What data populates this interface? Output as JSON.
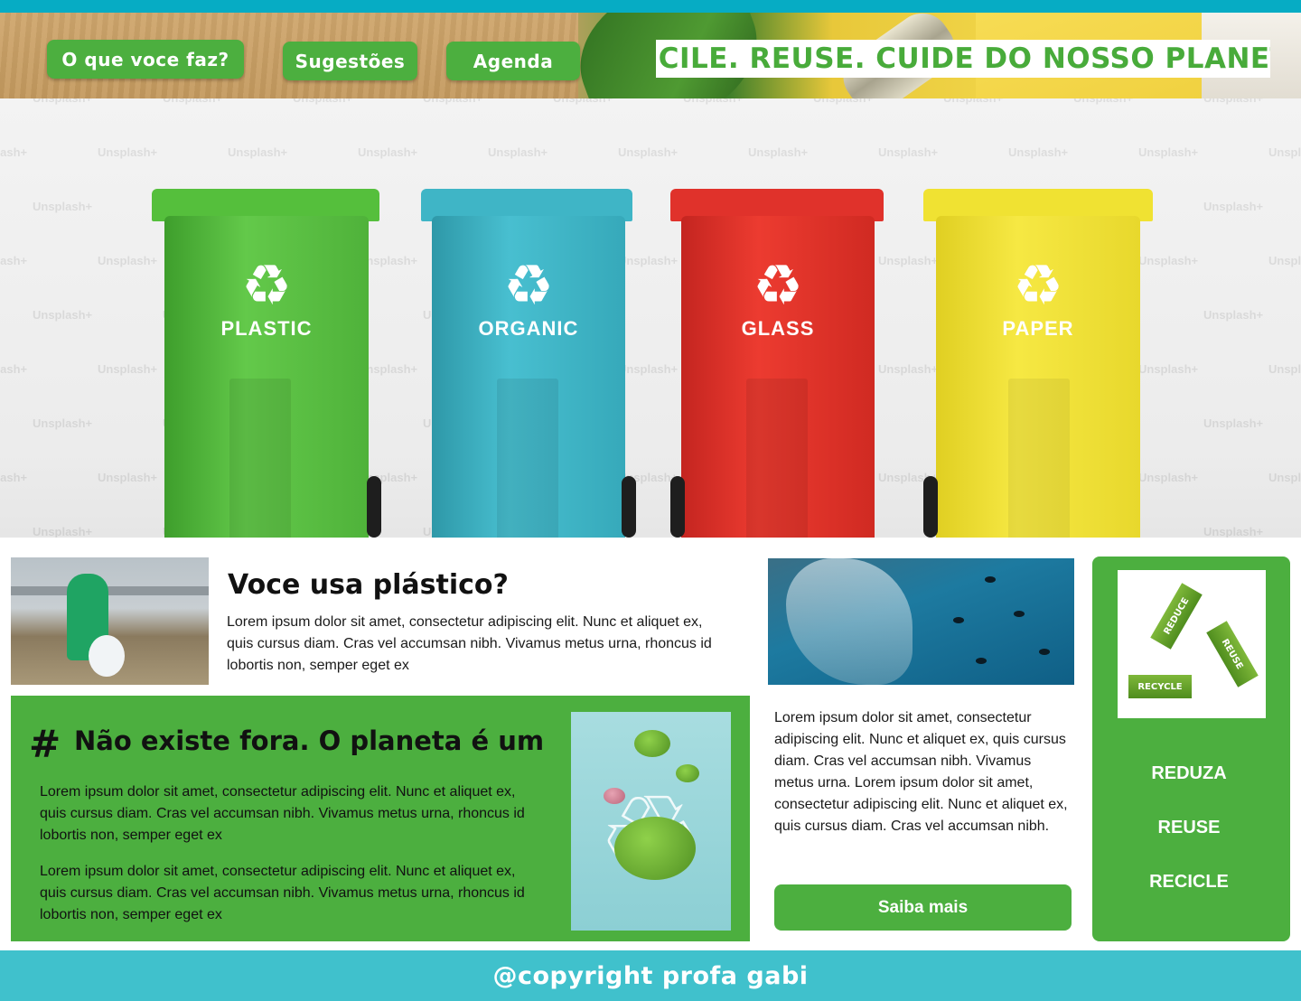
{
  "colors": {
    "brand_green": "#4caf3f",
    "top_strip": "#06acc4",
    "footer_bg": "#40c1cc",
    "bin_plastic": "#5cc644",
    "bin_organic": "#3fb8c9",
    "bin_glass": "#e8302a",
    "bin_paper": "#f2e53a"
  },
  "header": {
    "nav": [
      {
        "label": "O que voce faz?"
      },
      {
        "label": "Sugestões"
      },
      {
        "label": "Agenda"
      }
    ],
    "slogan": "RECILE. REUSE. CUIDE DO NOSSO PLANETA"
  },
  "hero": {
    "watermark": "Unsplash+",
    "recycle_icon": "recycle-icon",
    "bins": [
      {
        "label": "PLASTIC"
      },
      {
        "label": "ORGANIC"
      },
      {
        "label": "GLASS"
      },
      {
        "label": "PAPER"
      }
    ]
  },
  "plastic_section": {
    "title": "Voce usa plástico?",
    "text": "Lorem ipsum dolor sit amet, consectetur adipiscing elit. Nunc et aliquet ex, quis cursus diam. Cras vel accumsan nibh. Vivamus metus urna, rhoncus id lobortis non, semper eget ex"
  },
  "planet_section": {
    "hash": "#",
    "title": "Não existe fora. O planeta é um",
    "paragraph_1": "Lorem ipsum dolor sit amet, consectetur adipiscing elit. Nunc et aliquet ex, quis cursus diam. Cras vel accumsan nibh. Vivamus metus urna, rhoncus id lobortis non, semper eget ex",
    "paragraph_2": "Lorem ipsum dolor sit amet, consectetur adipiscing elit. Nunc et aliquet ex, quis cursus diam. Cras vel accumsan nibh. Vivamus metus urna, rhoncus id lobortis non, semper eget ex"
  },
  "ocean_section": {
    "text": "Lorem ipsum dolor sit amet, consectetur adipiscing elit. Nunc et aliquet ex, quis cursus diam. Cras vel accumsan nibh. Vivamus metus urna. Lorem ipsum dolor sit amet, consectetur adipiscing elit. Nunc et aliquet ex, quis cursus diam. Cras vel accumsan nibh.",
    "button_label": "Saiba mais"
  },
  "sidebar": {
    "logo_labels": [
      "REDUCE",
      "REUSE",
      "RECYCLE"
    ],
    "items": [
      "REDUZA",
      "REUSE",
      "RECICLE"
    ]
  },
  "footer": {
    "text": "@copyright profa gabi"
  }
}
